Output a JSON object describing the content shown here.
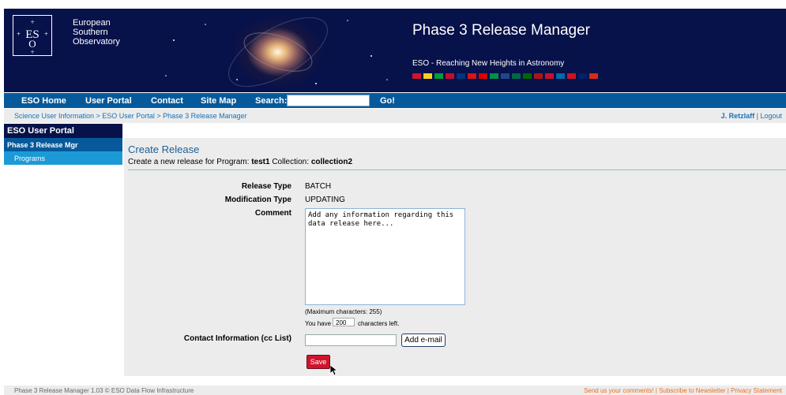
{
  "header": {
    "org_name": "European\nSouthern\nObservatory",
    "logo_text": "ESO",
    "app_title": "Phase 3 Release Manager",
    "tagline": "ESO - Reaching New Heights in Astronomy",
    "flag_colors": [
      "#cf142b",
      "#f7d11e",
      "#009b3a",
      "#c60c30",
      "#003580",
      "#d7141a",
      "#dd0000",
      "#009246",
      "#21468b",
      "#006847",
      "#006600",
      "#aa151b",
      "#c8102e",
      "#006aa7",
      "#ce1126",
      "#012169",
      "#d52b1e"
    ]
  },
  "nav": {
    "home": "ESO Home",
    "user_portal": "User Portal",
    "contact": "Contact",
    "site_map": "Site Map",
    "search_label": "Search:",
    "go": "Go!"
  },
  "breadcrumb": {
    "trail": "Science User Information > ESO User Portal > Phase 3 Release Manager",
    "user": "J. Retzlaff",
    "separator": "|",
    "logout": "Logout"
  },
  "sidebar": {
    "title": "ESO User Portal",
    "section": "Phase 3 Release Mgr",
    "item": "Programs"
  },
  "form": {
    "title": "Create Release",
    "desc_prefix": "Create a new release for Program:",
    "program": "test1",
    "collection_label": "Collection:",
    "collection": "collection2",
    "release_type_label": "Release Type",
    "release_type": "BATCH",
    "mod_type_label": "Modification Type",
    "mod_type": "UPDATING",
    "comment_label": "Comment",
    "comment_placeholder": "Add any information regarding this data release here...",
    "max_chars": "(Maximum characters: 255)",
    "chars_prefix": "You have",
    "chars_left_value": "200",
    "chars_suffix": "characters left.",
    "contact_label": "Contact Information (cc List)",
    "add_email": "Add e-mail",
    "save": "Save"
  },
  "footer": {
    "left": "Phase 3 Release Manager 1.03 © ESO Data Flow Infrastructure",
    "right": "Send us your comments! | Subscribe to Newsletter | Privacy Statement"
  }
}
